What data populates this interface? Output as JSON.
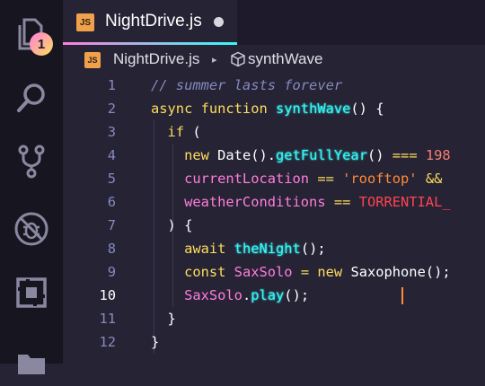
{
  "activity_bar": {
    "explorer_badge": "1",
    "icons": [
      "files-icon",
      "search-icon",
      "source-control-icon",
      "debug-icon",
      "extensions-icon",
      "folder-icon"
    ]
  },
  "tab": {
    "badge": "JS",
    "label": "NightDrive.js",
    "modified": true
  },
  "breadcrumb": {
    "badge": "JS",
    "file": "NightDrive.js",
    "separator": "▸",
    "symbol": "synthWave"
  },
  "editor": {
    "active_line": 10,
    "lines": [
      {
        "number": "1",
        "tokens": [
          {
            "t": "// summer lasts forever",
            "c": "comment"
          }
        ]
      },
      {
        "number": "2",
        "tokens": [
          {
            "t": "async function ",
            "c": "kw"
          },
          {
            "t": "synthWave",
            "c": "fn"
          },
          {
            "t": "() {",
            "c": "punc"
          }
        ]
      },
      {
        "number": "3",
        "tokens": [
          {
            "t": "  if",
            "c": "kw"
          },
          {
            "t": " (",
            "c": "punc"
          }
        ]
      },
      {
        "number": "4",
        "tokens": [
          {
            "t": "    new ",
            "c": "kw"
          },
          {
            "t": "Date",
            "c": "punc"
          },
          {
            "t": "().",
            "c": "punc"
          },
          {
            "t": "getFullYear",
            "c": "fn"
          },
          {
            "t": "() ",
            "c": "punc"
          },
          {
            "t": "===",
            "c": "op"
          },
          {
            "t": " 198",
            "c": "num"
          }
        ]
      },
      {
        "number": "5",
        "tokens": [
          {
            "t": "    currentLocation",
            "c": "var"
          },
          {
            "t": " == ",
            "c": "op"
          },
          {
            "t": "'rooftop'",
            "c": "str"
          },
          {
            "t": " &&",
            "c": "op"
          }
        ]
      },
      {
        "number": "6",
        "tokens": [
          {
            "t": "    weatherConditions",
            "c": "var"
          },
          {
            "t": " == ",
            "c": "op"
          },
          {
            "t": "TORRENTIAL_",
            "c": "class"
          }
        ]
      },
      {
        "number": "7",
        "tokens": [
          {
            "t": "  ) {",
            "c": "punc"
          }
        ]
      },
      {
        "number": "8",
        "tokens": [
          {
            "t": "    await ",
            "c": "kw"
          },
          {
            "t": "theNight",
            "c": "fn"
          },
          {
            "t": "();",
            "c": "punc"
          }
        ]
      },
      {
        "number": "9",
        "tokens": [
          {
            "t": "    const ",
            "c": "kw"
          },
          {
            "t": "SaxSolo",
            "c": "var"
          },
          {
            "t": " = ",
            "c": "op"
          },
          {
            "t": "new ",
            "c": "kw"
          },
          {
            "t": "Saxophone",
            "c": "punc"
          },
          {
            "t": "();",
            "c": "punc"
          }
        ]
      },
      {
        "number": "10",
        "tokens": [
          {
            "t": "    SaxSolo",
            "c": "var"
          },
          {
            "t": ".",
            "c": "punc"
          },
          {
            "t": "play",
            "c": "fn"
          },
          {
            "t": "();",
            "c": "punc"
          }
        ]
      },
      {
        "number": "11",
        "tokens": [
          {
            "t": "  }",
            "c": "punc"
          }
        ]
      },
      {
        "number": "12",
        "tokens": [
          {
            "t": "}",
            "c": "punc"
          }
        ]
      }
    ]
  }
}
